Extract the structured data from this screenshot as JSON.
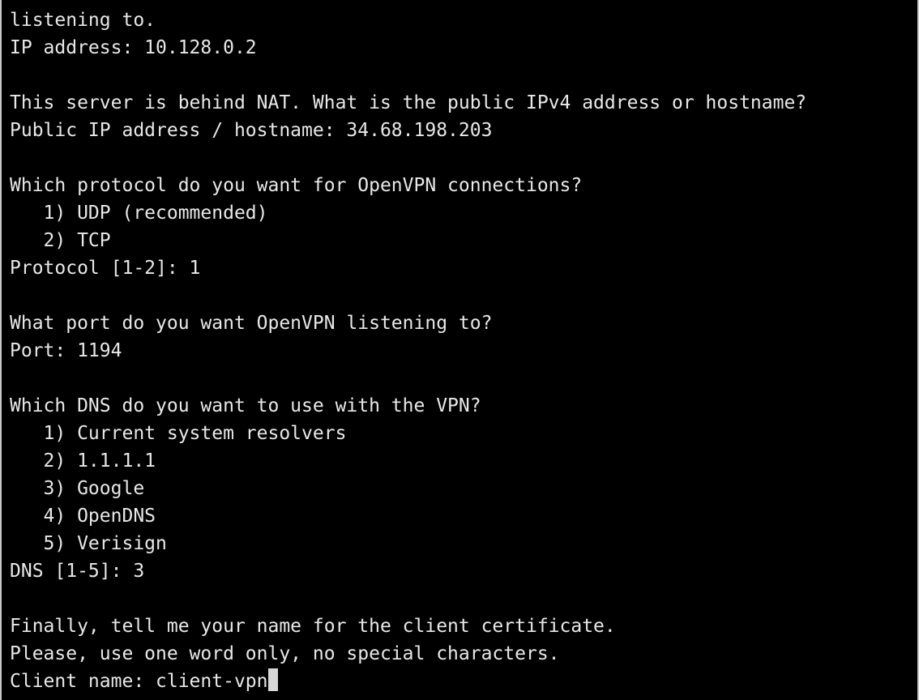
{
  "terminal": {
    "lines": [
      "listening to.",
      "IP address: 10.128.0.2",
      "",
      "This server is behind NAT. What is the public IPv4 address or hostname?",
      "Public IP address / hostname: 34.68.198.203",
      "",
      "Which protocol do you want for OpenVPN connections?",
      "   1) UDP (recommended)",
      "   2) TCP",
      "Protocol [1-2]: 1",
      "",
      "What port do you want OpenVPN listening to?",
      "Port: 1194",
      "",
      "Which DNS do you want to use with the VPN?",
      "   1) Current system resolvers",
      "   2) 1.1.1.1",
      "   3) Google",
      "   4) OpenDNS",
      "   5) Verisign",
      "DNS [1-5]: 3",
      "",
      "Finally, tell me your name for the client certificate.",
      "Please, use one word only, no special characters.",
      "Client name: client-vpn"
    ],
    "colors": {
      "background": "#000000",
      "text": "#e8e8e8",
      "cursor": "#d8d8d8"
    }
  }
}
